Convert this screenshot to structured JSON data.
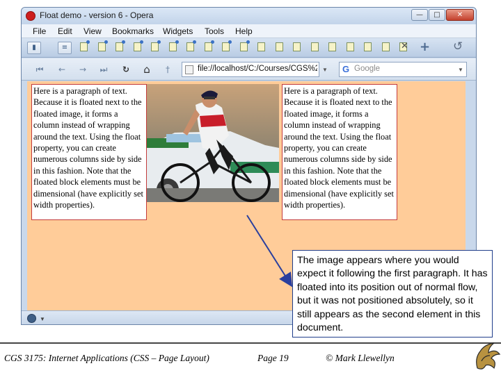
{
  "window": {
    "title": "Float demo - version 6 - Opera",
    "controls": {
      "minimize": "—",
      "maximize": "□",
      "close": "✕"
    }
  },
  "menu": {
    "items": [
      "File",
      "Edit",
      "View",
      "Bookmarks",
      "Widgets",
      "Tools",
      "Help"
    ]
  },
  "tabbar": {
    "more_indicator": "•••",
    "close_glyph": "✕",
    "add_glyph": "+",
    "trash_glyph": "↺"
  },
  "navigation": {
    "first": "⏮",
    "back": "←",
    "forward": "→",
    "last": "⏭",
    "reload": "↻",
    "home": "⌂",
    "wand": "†",
    "address": "file://localhost/C:/Courses/CGS%2",
    "search_engine_letter": "G",
    "search_placeholder": "Google",
    "dropdown_glyph": "▼"
  },
  "content": {
    "paragraph_1": "Here is a paragraph of text. Because it is floated next to the floated image, it forms a column instead of wrapping around the text. Using the float property, you can create numerous columns side by side in this fashion. Note that the floated block elements must be dimensional (have explicitly set width properties).",
    "paragraph_2": "Here is a paragraph of text. Because it is floated next to the floated image, it forms a column instead of wrapping around the text. Using the float property, you can create numerous columns side by side in this fashion. Note that the floated block elements must be dimensional (have explicitly set width properties).",
    "page_background": "#ffcc99",
    "box_border": "#c33b3b"
  },
  "callout": {
    "text": "The image appears where you would expect it following the first paragraph. It has floated into its position out of normal flow, but it was not positioned absolutely, so it still appears as the second element in this document."
  },
  "footer": {
    "course": "CGS 3175: Internet Applications (CSS – Page Layout)",
    "page": "Page 19",
    "author": "© Mark Llewellyn"
  }
}
